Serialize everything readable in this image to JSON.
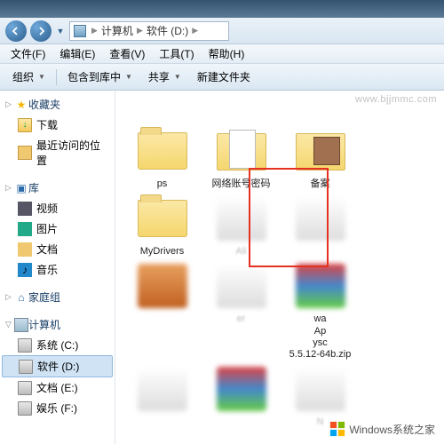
{
  "address": {
    "root": "计算机",
    "drive": "软件 (D:)"
  },
  "menu": {
    "file": "文件(F)",
    "edit": "编辑(E)",
    "view": "查看(V)",
    "tools": "工具(T)",
    "help": "帮助(H)"
  },
  "toolbar": {
    "organize": "组织",
    "include": "包含到库中",
    "share": "共享",
    "newfolder": "新建文件夹"
  },
  "sidebar": {
    "favorites": "收藏夹",
    "downloads": "下载",
    "recent": "最近访问的位置",
    "libraries": "库",
    "videos": "视频",
    "pictures": "图片",
    "documents": "文档",
    "music": "音乐",
    "homegroup": "家庭组",
    "computer": "计算机",
    "drive_c": "系统 (C:)",
    "drive_d": "软件 (D:)",
    "drive_e": "文档 (E:)",
    "drive_f": "娱乐 (F:)"
  },
  "items": {
    "ps": "ps",
    "netpwd": "网络账号密码",
    "beian": "备案",
    "mydrivers": "MyDrivers",
    "ali": "Ali",
    "ver": "er",
    "zip": "5.5.12-64b.zip",
    "wa": "wa",
    "ap": "Ap",
    "ysc": "ysc",
    "n": "N"
  },
  "watermark": {
    "text": "Windows系统之家",
    "url": "www.bjjmmc.com"
  }
}
